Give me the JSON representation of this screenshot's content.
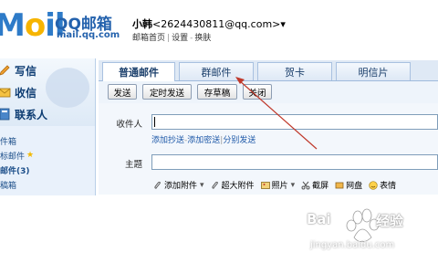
{
  "header": {
    "logo_m": "M",
    "logo_o": "o",
    "logo_il": "il",
    "logo_qq": "QQ邮箱",
    "logo_url": "mail.qq.com",
    "user_name": "小韩",
    "user_email": "<2624430811@qq.com>",
    "user_menu": "▾",
    "link_home": "邮箱首页",
    "link_settings": "设置",
    "link_skin": "换肤",
    "sep": "|",
    "dash": "-"
  },
  "sidebar": {
    "write": "写信",
    "inbox": "收信",
    "contacts": "联系人",
    "folders": [
      {
        "label": "件箱",
        "bold": false
      },
      {
        "label": "标邮件",
        "bold": false
      },
      {
        "label": "邮件(3)",
        "bold": true
      },
      {
        "label": "稿箱",
        "bold": false
      }
    ],
    "star": "★"
  },
  "tabs": [
    {
      "label": "普通邮件",
      "active": true
    },
    {
      "label": "群邮件",
      "active": false
    },
    {
      "label": "贺卡",
      "active": false
    },
    {
      "label": "明信片",
      "active": false
    }
  ],
  "toolbar": {
    "send": "发送",
    "scheduled": "定时发送",
    "save_draft": "存草稿",
    "close": "关闭"
  },
  "compose": {
    "to_label": "收件人",
    "add_cc": "添加抄送",
    "add_bcc": "添加密送",
    "separate_send": "分别发送",
    "subject_label": "主题",
    "attach": "添加附件",
    "big_attach": "超大附件",
    "photo": "照片",
    "screenshot": "截屏",
    "netdisk": "网盘",
    "emoji": "表情"
  },
  "watermark": {
    "brand": "Bai",
    "jingyan": "经验",
    "url": "jingyan.baidu.com"
  },
  "colors": {
    "accent": "#2462ad",
    "arrow": "#c0392b",
    "star": "#f2b800"
  }
}
